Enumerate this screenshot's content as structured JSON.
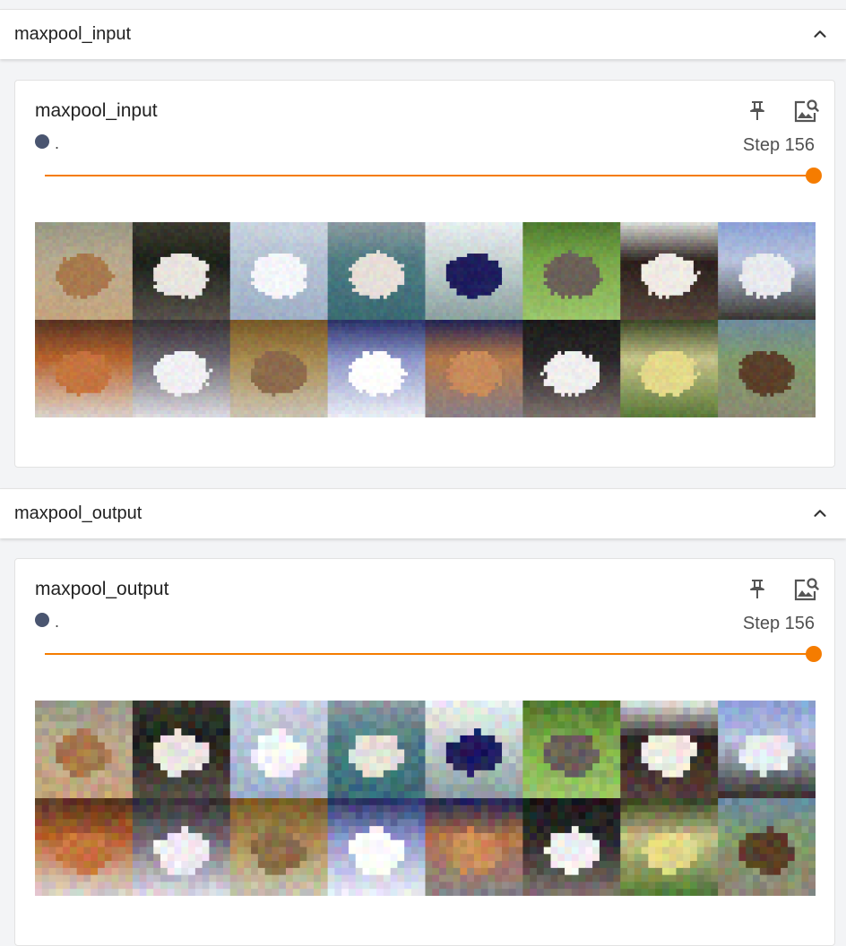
{
  "sections": [
    {
      "header": "maxpool_input",
      "card": {
        "title": "maxpool_input",
        "run_name": ".",
        "run_color": "#4a5570",
        "step_text": "Step 156",
        "slider_fraction": 1.0
      }
    },
    {
      "header": "maxpool_output",
      "card": {
        "title": "maxpool_output",
        "run_name": ".",
        "run_color": "#4a5570",
        "step_text": "Step 156",
        "slider_fraction": 1.0
      }
    }
  ],
  "icons": {
    "collapse": "chevron-up-icon",
    "pin": "pin-icon",
    "image_search": "image-search-icon"
  },
  "accent_color": "#f57c00"
}
